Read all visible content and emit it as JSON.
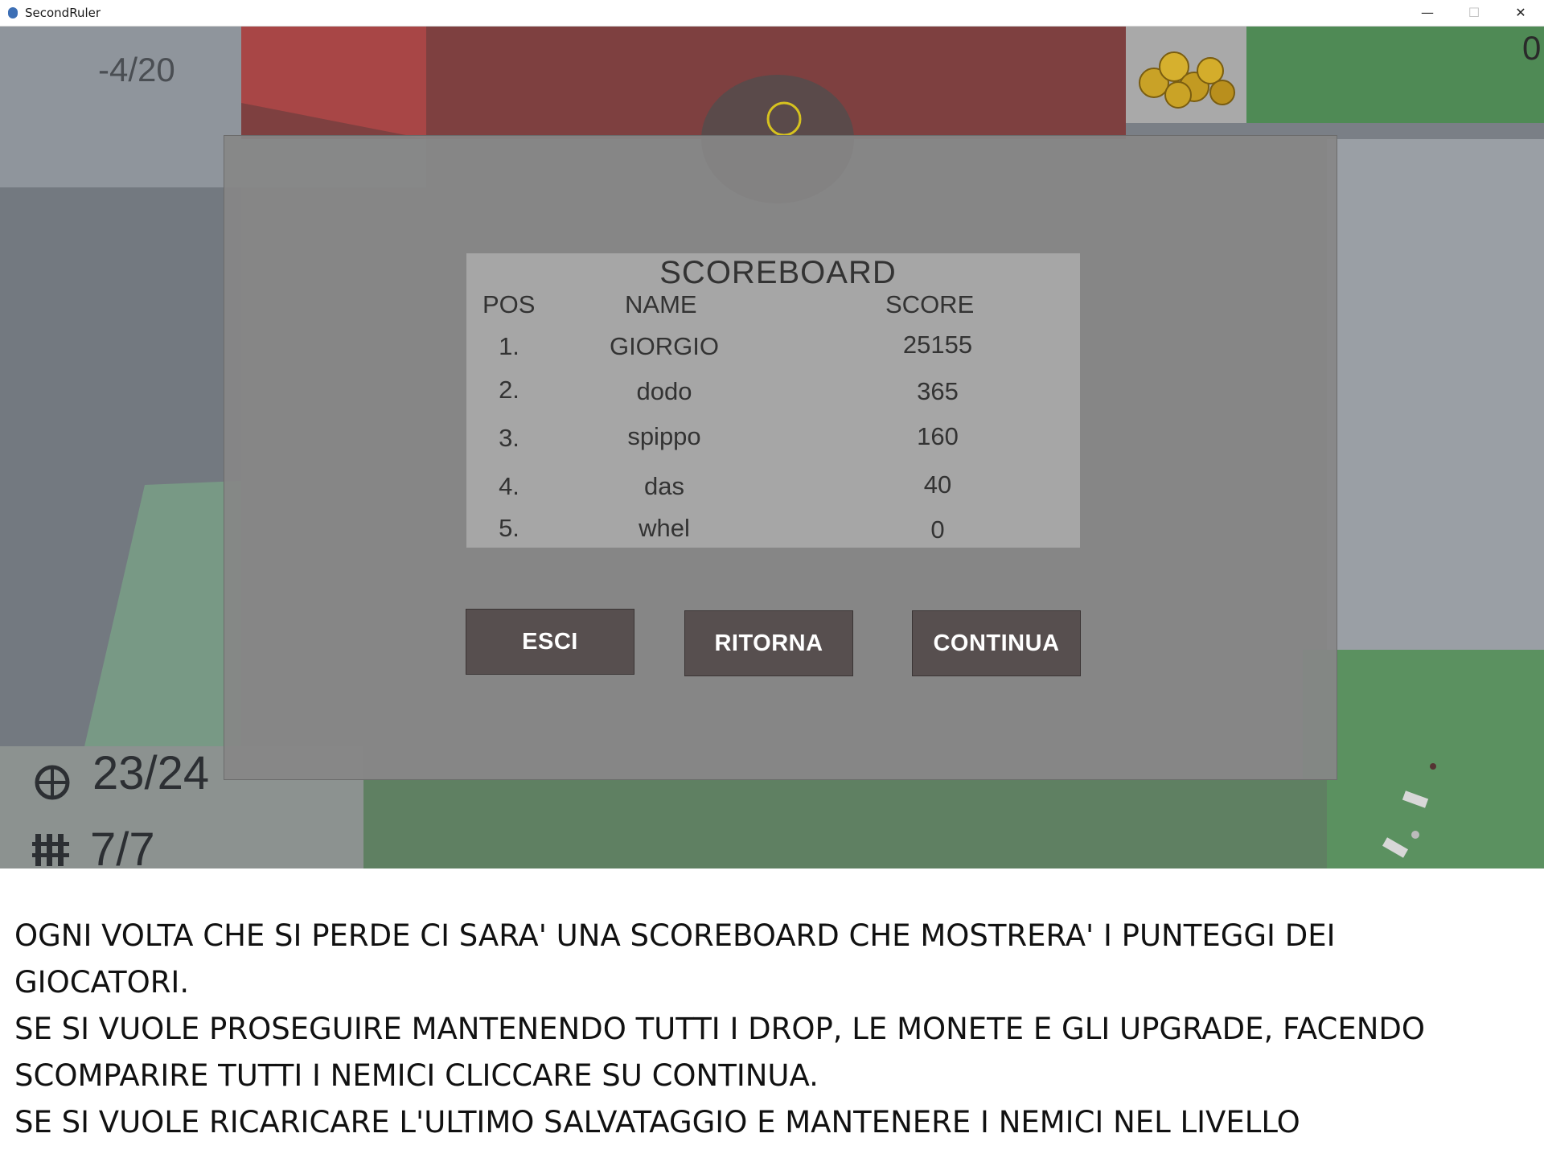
{
  "window": {
    "title": "SecondRuler",
    "minimize": "—",
    "maximize": "☐",
    "close": "✕"
  },
  "hud": {
    "wave": "-4/20",
    "coins": "0",
    "ammo": "23/24",
    "magazines": "7/7",
    "icons": {
      "ammo": "crosshair-icon",
      "magazines": "bullets-icon",
      "coins": "gold-coins-icon"
    }
  },
  "scoreboard": {
    "title": "SCOREBOARD",
    "headers": {
      "pos": "POS",
      "name": "NAME",
      "score": "SCORE"
    },
    "rows": [
      {
        "pos": "1.",
        "name": "GIORGIO",
        "score": "25155"
      },
      {
        "pos": "2.",
        "name": "dodo",
        "score": "365"
      },
      {
        "pos": "3.",
        "name": "spippo",
        "score": "160"
      },
      {
        "pos": "4.",
        "name": "das",
        "score": "40"
      },
      {
        "pos": "5.",
        "name": "whel",
        "score": "0"
      }
    ]
  },
  "buttons": {
    "exit": "ESCI",
    "back": "RITORNA",
    "continue": "CONTINUA"
  },
  "caption": {
    "lines": [
      "OGNI VOLTA CHE SI PERDE CI SARA' UNA SCOREBOARD CHE MOSTRERA' I PUNTEGGI DEI",
      "GIOCATORI.",
      "SE SI VUOLE PROSEGUIRE MANTENENDO TUTTI I DROP, LE MONETE E GLI UPGRADE, FACENDO",
      "SCOMPARIRE TUTTI I NEMICI CLICCARE SU CONTINUA.",
      "SE SI VUOLE RICARICARE L'ULTIMO SALVATAGGIO E MANTENERE I NEMICI NEL LIVELLO"
    ]
  },
  "colors": {
    "modal_bg": "#878787",
    "scoreboard_bg": "#a6a6a6",
    "button_bg": "#574f4f",
    "button_text": "#ffffff",
    "ground_green": "#5f8a63",
    "red_floor": "#8a3b3b"
  }
}
